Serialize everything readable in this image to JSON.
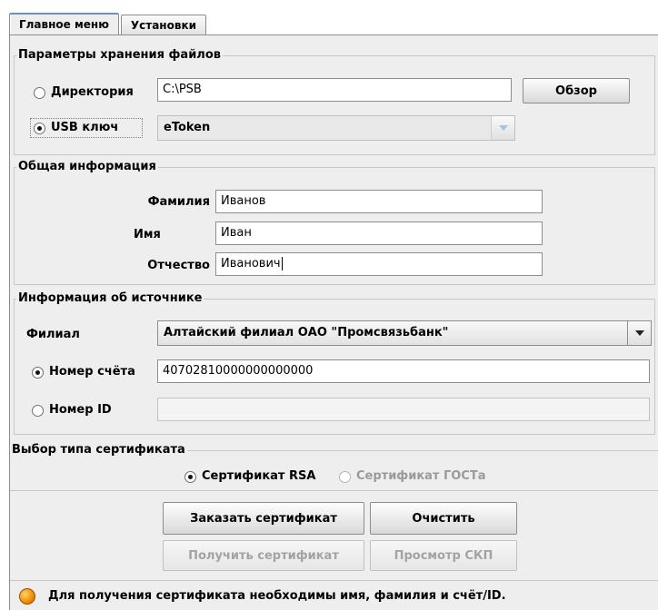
{
  "tabs": [
    {
      "label": "Главное меню",
      "active": true
    },
    {
      "label": "Установки",
      "active": false
    }
  ],
  "storage": {
    "title": "Параметры хранения файлов",
    "directory_label": "Директория",
    "directory_selected": false,
    "directory_value": "C:\\PSB",
    "browse_label": "Обзор",
    "usb_label": "USB ключ",
    "usb_selected": true,
    "usb_value": "eToken"
  },
  "general": {
    "title": "Общая информация",
    "surname_label": "Фамилия",
    "surname_value": "Иванов",
    "name_label": "Имя",
    "name_value": "Иван",
    "patronymic_label": "Отчество",
    "patronymic_value": "Иванович"
  },
  "source": {
    "title": "Информация об источнике",
    "branch_label": "Филиал",
    "branch_value": "Алтайский филиал ОАО \"Промсвязьбанк\"",
    "account_label": "Номер счёта",
    "account_selected": true,
    "account_value": "40702810000000000000",
    "id_label": "Номер ID",
    "id_selected": false,
    "id_value": ""
  },
  "certificate_type": {
    "title": "Выбор типа сертификата",
    "rsa_label": "Сертификат RSA",
    "rsa_selected": true,
    "gost_label": "Сертификат ГОСТа",
    "gost_selected": false,
    "gost_enabled": false
  },
  "actions": {
    "order_label": "Заказать сертификат",
    "clear_label": "Очистить",
    "get_label": "Получить сертификат",
    "view_label": "Просмотр СКП"
  },
  "status": {
    "message": "Для получения сертификата необходимы имя, фамилия и счёт/ID.",
    "icon": "warning-dot-icon",
    "icon_color": "#f08a00"
  }
}
